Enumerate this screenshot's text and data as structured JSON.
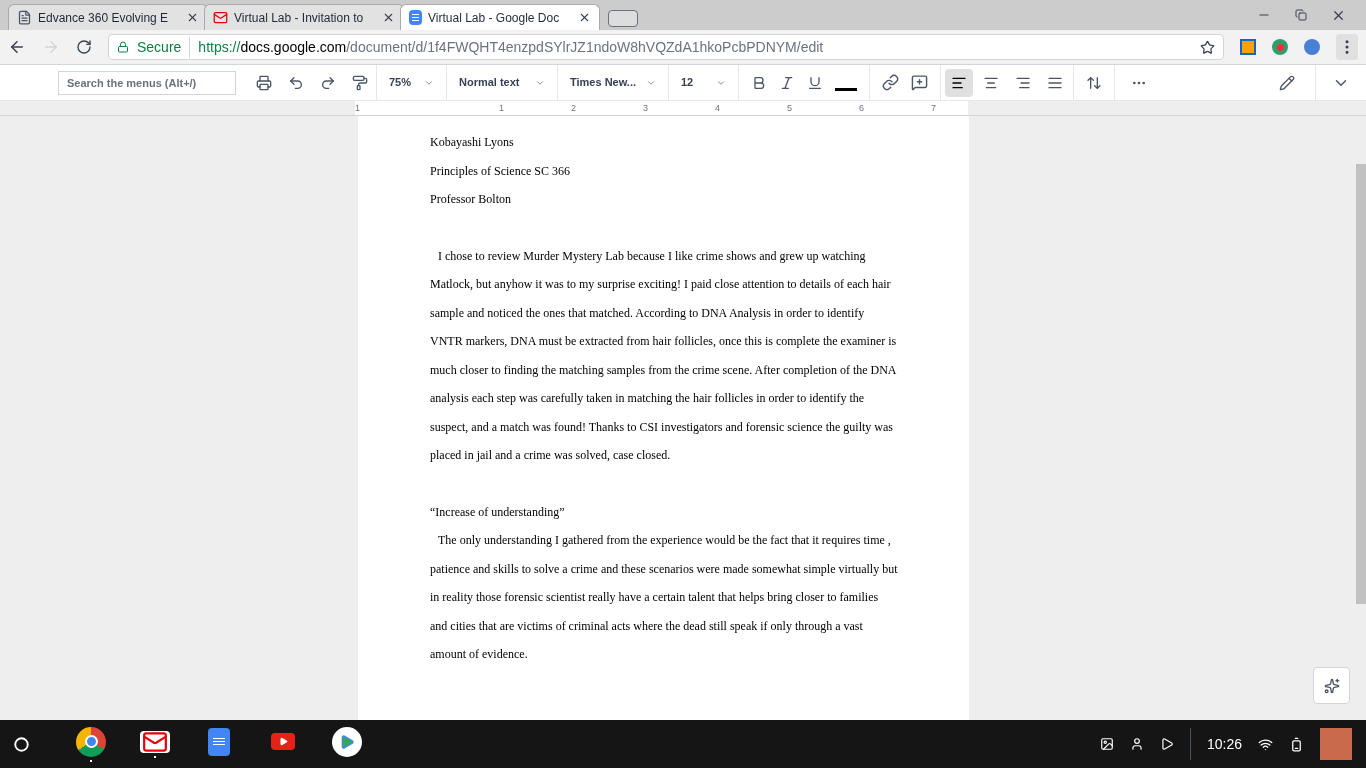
{
  "tabs": [
    {
      "title": "Edvance 360 Evolving E",
      "kind": "page",
      "selected": false
    },
    {
      "title": "Virtual Lab - Invitation to",
      "kind": "mail",
      "selected": false
    },
    {
      "title": "Virtual Lab - Google Doc",
      "kind": "doc",
      "selected": true
    }
  ],
  "address_bar": {
    "secure_label": "Secure",
    "url_scheme": "https://",
    "url_host": "docs.google.com",
    "url_path": "/document/d/1f4FWQHT4enzpdSYlrJZ1ndoW8hVQZdA1hkoPcbPDNYM/edit"
  },
  "toolbar": {
    "search": {
      "placeholder": "Search the menus (Alt+/)"
    },
    "zoom": "75%",
    "style": "Normal text",
    "font": "Times New...",
    "size": "12",
    "alignment": [
      {
        "kind": "left",
        "selected": true
      },
      {
        "kind": "center",
        "selected": false
      },
      {
        "kind": "right",
        "selected": false
      },
      {
        "kind": "justify",
        "selected": false
      }
    ]
  },
  "ruler": {
    "labels": [
      "1",
      "1",
      "2",
      "3",
      "4",
      "5",
      "6",
      "7"
    ]
  },
  "document": {
    "header_lines": [
      "Kobayashi Lyons",
      "Principles of Science SC 366",
      "Professor Bolton"
    ],
    "paragraphs": [
      {
        "kind": "body",
        "text": "I chose to review Murder Mystery Lab because I like crime shows and grew up watching Matlock, but anyhow it was to my surprise exciting! I paid close attention to details of each hair sample and noticed the ones that matched. According to DNA Analysis in order to identify VNTR markers, DNA must be extracted from hair follicles, once this is complete the examiner is much closer to finding the matching samples from the crime scene. After completion of the DNA analysis each step was carefully taken in matching the hair follicles in order to identify the suspect, and a match was found! Thanks to CSI investigators and forensic science the guilty was placed in jail and a crime was solved, case closed."
      },
      {
        "kind": "heading",
        "text": "“Increase of understanding”"
      },
      {
        "kind": "body",
        "text": "The only understanding I gathered from the experience would be the fact that it requires time , patience and skills to solve a crime and these scenarios were made somewhat simple virtually but in reality those forensic scientist really have a certain talent that helps bring closer to families and cities that are victims of criminal acts where the dead still speak if only through a vast amount of evidence."
      }
    ]
  },
  "shelf": {
    "apps": [
      {
        "kind": "chrome",
        "running": true
      },
      {
        "kind": "gmail",
        "running": true
      },
      {
        "kind": "docs",
        "running": false
      },
      {
        "kind": "youtube",
        "running": false
      },
      {
        "kind": "play",
        "running": false
      }
    ],
    "time": "10:26"
  }
}
